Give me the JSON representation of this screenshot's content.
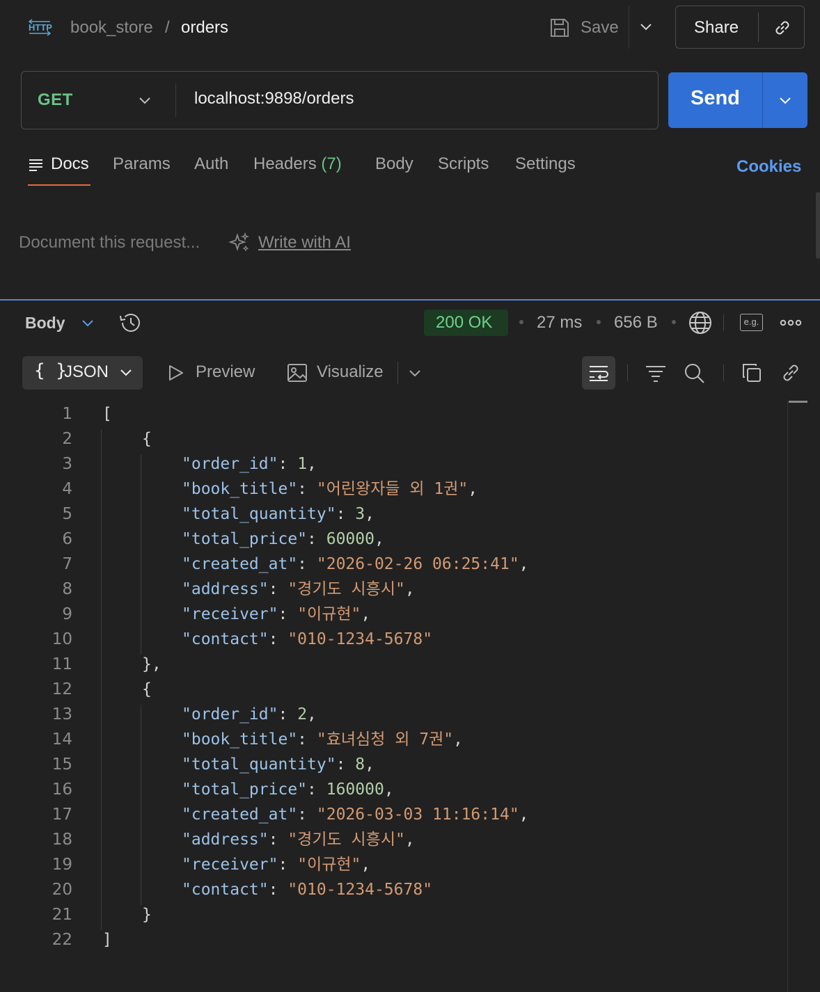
{
  "header": {
    "protocol_badge": "HTTP",
    "breadcrumb_parent": "book_store",
    "breadcrumb_separator": "/",
    "breadcrumb_current": "orders",
    "save_label": "Save",
    "share_label": "Share"
  },
  "request": {
    "method": "GET",
    "url": "localhost:9898/orders",
    "send_label": "Send"
  },
  "tabs": [
    {
      "label": "Docs"
    },
    {
      "label": "Params"
    },
    {
      "label": "Auth"
    },
    {
      "label": "Headers",
      "count": "(7)"
    },
    {
      "label": "Body"
    },
    {
      "label": "Scripts"
    },
    {
      "label": "Settings"
    }
  ],
  "cookies_label": "Cookies",
  "docs": {
    "placeholder": "Document this request...",
    "ai_link": "Write with AI"
  },
  "response": {
    "section_label": "Body",
    "status": "200 OK",
    "time": "27 ms",
    "size": "656 B",
    "example_badge": "e.g.",
    "format_label": "JSON",
    "format_icon": "{ }",
    "preview_label": "Preview",
    "visualize_label": "Visualize"
  },
  "colors": {
    "accent": "#2f6fd6",
    "status_ok": "#6cd38c",
    "method_get": "#6cc287",
    "active_tab_underline": "#e8693c",
    "cookies_link": "#5a9cf0"
  },
  "code_lines": [
    {
      "n": "1",
      "indent": 0,
      "parts": [
        [
          "p",
          "["
        ]
      ]
    },
    {
      "n": "2",
      "indent": 1,
      "parts": [
        [
          "p",
          "{"
        ]
      ]
    },
    {
      "n": "3",
      "indent": 2,
      "parts": [
        [
          "k",
          "\"order_id\""
        ],
        [
          "p",
          ": "
        ],
        [
          "n",
          "1"
        ],
        [
          "p",
          ","
        ]
      ]
    },
    {
      "n": "4",
      "indent": 2,
      "parts": [
        [
          "k",
          "\"book_title\""
        ],
        [
          "p",
          ": "
        ],
        [
          "s",
          "\"어린왕자들 외 1권\""
        ],
        [
          "p",
          ","
        ]
      ]
    },
    {
      "n": "5",
      "indent": 2,
      "parts": [
        [
          "k",
          "\"total_quantity\""
        ],
        [
          "p",
          ": "
        ],
        [
          "n",
          "3"
        ],
        [
          "p",
          ","
        ]
      ]
    },
    {
      "n": "6",
      "indent": 2,
      "parts": [
        [
          "k",
          "\"total_price\""
        ],
        [
          "p",
          ": "
        ],
        [
          "n",
          "60000"
        ],
        [
          "p",
          ","
        ]
      ]
    },
    {
      "n": "7",
      "indent": 2,
      "parts": [
        [
          "k",
          "\"created_at\""
        ],
        [
          "p",
          ": "
        ],
        [
          "s",
          "\"2026-02-26 06:25:41\""
        ],
        [
          "p",
          ","
        ]
      ]
    },
    {
      "n": "8",
      "indent": 2,
      "parts": [
        [
          "k",
          "\"address\""
        ],
        [
          "p",
          ": "
        ],
        [
          "s",
          "\"경기도 시흥시\""
        ],
        [
          "p",
          ","
        ]
      ]
    },
    {
      "n": "9",
      "indent": 2,
      "parts": [
        [
          "k",
          "\"receiver\""
        ],
        [
          "p",
          ": "
        ],
        [
          "s",
          "\"이규현\""
        ],
        [
          "p",
          ","
        ]
      ]
    },
    {
      "n": "10",
      "indent": 2,
      "parts": [
        [
          "k",
          "\"contact\""
        ],
        [
          "p",
          ": "
        ],
        [
          "s",
          "\"010-1234-5678\""
        ]
      ]
    },
    {
      "n": "11",
      "indent": 1,
      "parts": [
        [
          "p",
          "},"
        ]
      ]
    },
    {
      "n": "12",
      "indent": 1,
      "parts": [
        [
          "p",
          "{"
        ]
      ]
    },
    {
      "n": "13",
      "indent": 2,
      "parts": [
        [
          "k",
          "\"order_id\""
        ],
        [
          "p",
          ": "
        ],
        [
          "n",
          "2"
        ],
        [
          "p",
          ","
        ]
      ]
    },
    {
      "n": "14",
      "indent": 2,
      "parts": [
        [
          "k",
          "\"book_title\""
        ],
        [
          "p",
          ": "
        ],
        [
          "s",
          "\"효녀심청 외 7권\""
        ],
        [
          "p",
          ","
        ]
      ]
    },
    {
      "n": "15",
      "indent": 2,
      "parts": [
        [
          "k",
          "\"total_quantity\""
        ],
        [
          "p",
          ": "
        ],
        [
          "n",
          "8"
        ],
        [
          "p",
          ","
        ]
      ]
    },
    {
      "n": "16",
      "indent": 2,
      "parts": [
        [
          "k",
          "\"total_price\""
        ],
        [
          "p",
          ": "
        ],
        [
          "n",
          "160000"
        ],
        [
          "p",
          ","
        ]
      ]
    },
    {
      "n": "17",
      "indent": 2,
      "parts": [
        [
          "k",
          "\"created_at\""
        ],
        [
          "p",
          ": "
        ],
        [
          "s",
          "\"2026-03-03 11:16:14\""
        ],
        [
          "p",
          ","
        ]
      ]
    },
    {
      "n": "18",
      "indent": 2,
      "parts": [
        [
          "k",
          "\"address\""
        ],
        [
          "p",
          ": "
        ],
        [
          "s",
          "\"경기도 시흥시\""
        ],
        [
          "p",
          ","
        ]
      ]
    },
    {
      "n": "19",
      "indent": 2,
      "parts": [
        [
          "k",
          "\"receiver\""
        ],
        [
          "p",
          ": "
        ],
        [
          "s",
          "\"이규현\""
        ],
        [
          "p",
          ","
        ]
      ]
    },
    {
      "n": "20",
      "indent": 2,
      "parts": [
        [
          "k",
          "\"contact\""
        ],
        [
          "p",
          ": "
        ],
        [
          "s",
          "\"010-1234-5678\""
        ]
      ]
    },
    {
      "n": "21",
      "indent": 1,
      "parts": [
        [
          "p",
          "}"
        ]
      ]
    },
    {
      "n": "22",
      "indent": 0,
      "parts": [
        [
          "p",
          "]"
        ]
      ]
    }
  ]
}
